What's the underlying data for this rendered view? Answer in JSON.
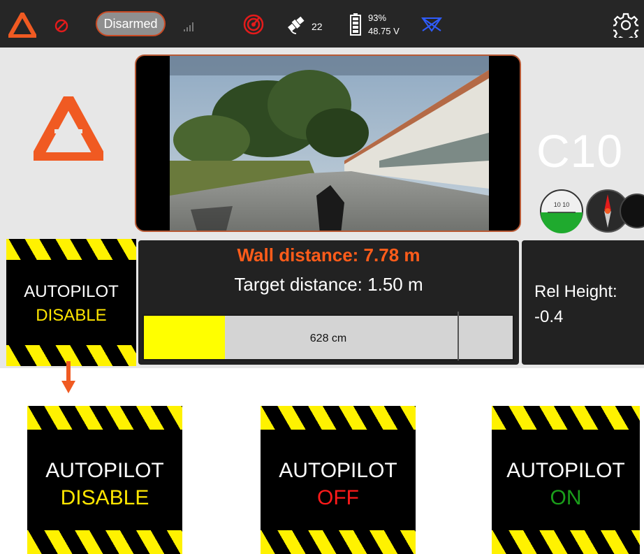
{
  "topbar": {
    "arm_status": "Disarmed",
    "gps_satellites": "22",
    "battery_percent": "93%",
    "battery_voltage": "48.75 V",
    "icons": [
      "app-logo-icon",
      "no-entry-icon",
      "signal-strength-icon",
      "rc-link-icon",
      "gps-satellite-icon",
      "battery-icon",
      "flight-mode-icon",
      "gear-icon"
    ]
  },
  "vehicle": {
    "callsign": "C10"
  },
  "distance": {
    "wall_label": "Wall distance: 7.78 m",
    "target_label": "Target distance: 1.50 m",
    "bar_label": "628 cm",
    "bar_fill_fraction": 0.22,
    "bar_marker_fraction": 0.85,
    "bar_fill_color": "#ffff00"
  },
  "height": {
    "label": "Rel Height:",
    "value": "-0.4"
  },
  "autopilot_indicator": {
    "title": "AUTOPILOT",
    "state": "DISABLE"
  },
  "autopilot_states": [
    {
      "title": "AUTOPILOT",
      "state": "DISABLE",
      "color": "#ffe600"
    },
    {
      "title": "AUTOPILOT",
      "state": "OFF",
      "color": "#ff1a1a"
    },
    {
      "title": "AUTOPILOT",
      "state": "ON",
      "color": "#1a9e1a"
    }
  ],
  "colors": {
    "accent_orange": "#f05a22",
    "topbar_bg": "#262626",
    "hazard_yellow": "#fff200"
  }
}
